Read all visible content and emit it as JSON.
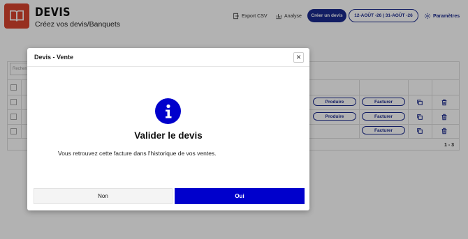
{
  "header": {
    "title": "DEVIS",
    "subtitle": "Créez vos devis/Banquets",
    "export_label": "Export CSV",
    "analyse_label": "Analyse",
    "create_label": "Créer un devis",
    "date_range": "12-AOÛT -26 | 31-AOÛT -26",
    "settings_label": "Paramètres"
  },
  "table": {
    "search_placeholder": "Recherche",
    "rows": [
      {
        "produce_label": "Produire",
        "invoice_label": "Facturer"
      },
      {
        "produce_label": "Produire",
        "invoice_label": "Facturer"
      },
      {
        "produce_label": "",
        "invoice_label": "Facturer"
      }
    ],
    "pagination": "1 - 3"
  },
  "modal": {
    "title": "Devis - Vente",
    "close_symbol": "✕",
    "heading": "Valider le devis",
    "message": "Vous retrouvez cette facture dans l'historique de vos ventes.",
    "no_label": "Non",
    "yes_label": "Oui"
  },
  "colors": {
    "brand_red": "#d9442f",
    "primary_blue": "#0000cc",
    "navy": "#1b2a8f"
  },
  "icons": [
    "book-icon",
    "export-icon",
    "chart-icon",
    "gear-icon",
    "copy-icon",
    "trash-icon",
    "info-icon",
    "close-icon"
  ]
}
